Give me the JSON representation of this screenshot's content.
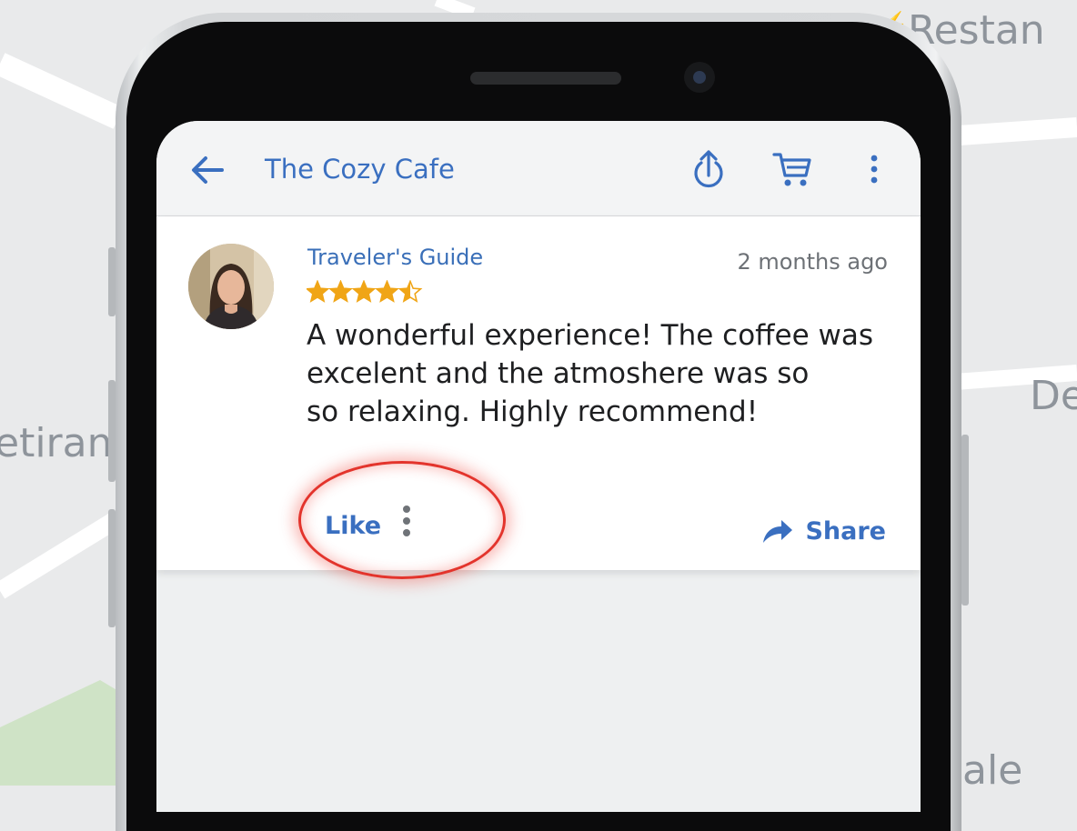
{
  "map": {
    "labels": [
      "Restan",
      "De",
      "etiran",
      "ale"
    ]
  },
  "app": {
    "title": "The Cozy Cafe",
    "accent": "#3a6fc0",
    "icons": [
      "back-arrow-icon",
      "share-upload-icon",
      "cart-icon",
      "more-vert-icon"
    ]
  },
  "review": {
    "author": "Traveler's Guide",
    "time": "2 months ago",
    "rating": 4.5,
    "rating_max": 5,
    "star_color": "#f0a516",
    "text": "A wonderful experience! The coffee was\nexcelent and the atmoshere was so\nso relaxing. Highly recommend!",
    "like_label": "Like",
    "share_label": "Share"
  },
  "annotation": {
    "color": "#e3342c",
    "target": "like-and-more-options"
  }
}
